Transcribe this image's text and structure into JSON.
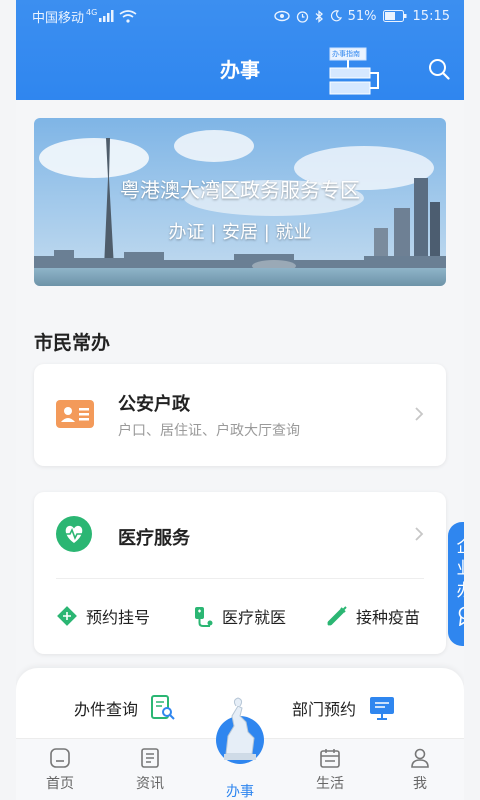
{
  "status_bar": {
    "carrier": "中国移动",
    "network": "4G",
    "battery": "51%",
    "time": "15:15"
  },
  "header": {
    "title": "办事",
    "guide_label": "办事指南"
  },
  "banner": {
    "title": "粤港澳大湾区政务服务专区",
    "subtitle": "办证 | 安居 | 就业"
  },
  "section": {
    "title": "市民常办"
  },
  "cards": {
    "police": {
      "name": "公安户政",
      "desc": "户口、居住证、户政大厅查询"
    },
    "medical": {
      "name": "医疗服务",
      "items": [
        {
          "label": "预约挂号",
          "icon": "appointment-icon"
        },
        {
          "label": "医疗就医",
          "icon": "medical-visit-icon"
        },
        {
          "label": "接种疫苗",
          "icon": "vaccine-icon"
        }
      ]
    }
  },
  "float_tab": {
    "chars": [
      "企",
      "业",
      "办"
    ]
  },
  "bottom_panel": {
    "query": "办件查询",
    "appointment": "部门预约"
  },
  "tabs": [
    {
      "label": "首页",
      "icon": "home-icon"
    },
    {
      "label": "资讯",
      "icon": "news-icon"
    },
    {
      "label": "办事",
      "icon": "ram-statue-icon"
    },
    {
      "label": "生活",
      "icon": "calendar-icon"
    },
    {
      "label": "我",
      "icon": "user-icon"
    }
  ],
  "colors": {
    "brand": "#2f86ef",
    "orange": "#f39a5a",
    "green": "#2bb673"
  }
}
